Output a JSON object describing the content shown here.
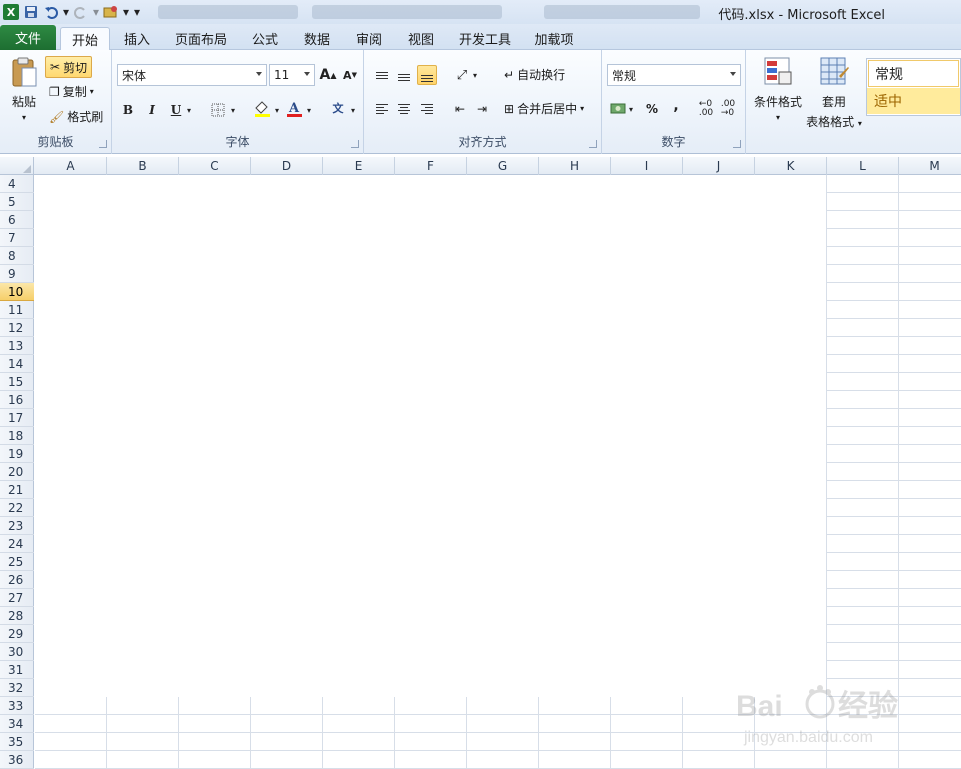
{
  "window": {
    "title": "代码.xlsx - Microsoft Excel"
  },
  "tabs": [
    {
      "label": "文件",
      "active": false
    },
    {
      "label": "开始",
      "active": true
    },
    {
      "label": "插入",
      "active": false
    },
    {
      "label": "页面布局",
      "active": false
    },
    {
      "label": "公式",
      "active": false
    },
    {
      "label": "数据",
      "active": false
    },
    {
      "label": "审阅",
      "active": false
    },
    {
      "label": "视图",
      "active": false
    },
    {
      "label": "开发工具",
      "active": false
    },
    {
      "label": "加载项",
      "active": false
    }
  ],
  "clipboard": {
    "paste": "粘贴",
    "cut": "剪切",
    "copy": "复制",
    "format_painter": "格式刷",
    "label": "剪贴板"
  },
  "font": {
    "name": "宋体",
    "size": "11",
    "label": "字体",
    "bold": "B",
    "italic": "I",
    "underline": "U"
  },
  "alignment": {
    "wrap": "自动换行",
    "merge": "合并后居中",
    "label": "对齐方式"
  },
  "number": {
    "format": "常规",
    "percent": "%",
    "comma": ",",
    "label": "数字"
  },
  "styles": {
    "conditional": "条件格式",
    "table_format_1": "套用",
    "table_format_2": "表格格式",
    "style_normal": "常规",
    "style_neutral": "适中"
  },
  "columns": [
    "A",
    "B",
    "C",
    "D",
    "E",
    "F",
    "G",
    "H",
    "I",
    "J",
    "K",
    "L",
    "M"
  ],
  "rows": [
    "4",
    "5",
    "6",
    "7",
    "8",
    "9",
    "10",
    "11",
    "12",
    "13",
    "14",
    "15",
    "16",
    "17",
    "18",
    "19",
    "20",
    "21",
    "22",
    "23",
    "24",
    "25",
    "26",
    "27",
    "28",
    "29",
    "30",
    "31",
    "32",
    "33",
    "34",
    "35",
    "36"
  ],
  "active_row": "10",
  "colors": {
    "file_tab": "#1d6e31",
    "active_row": "#f6cf6a",
    "style_neutral_bg": "#ffeb9c"
  }
}
